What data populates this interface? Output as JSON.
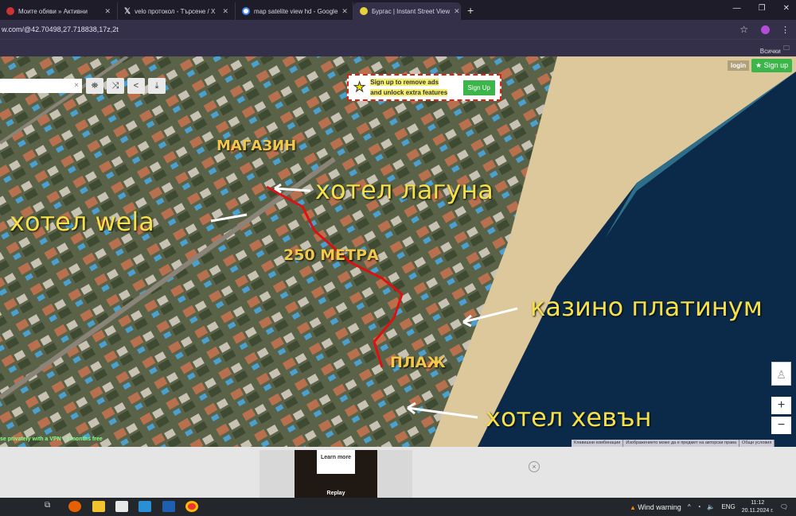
{
  "browser": {
    "tabs": [
      {
        "label": "Моите обяви » Активни",
        "active": false
      },
      {
        "label": "velo протокол - Търсене / X",
        "active": false
      },
      {
        "label": "map satelite view hd - Google",
        "active": false
      },
      {
        "label": "Бургас | Instant Street View",
        "active": true
      }
    ],
    "url": "w.com/@42.70498,27.718838,17z,2t",
    "bookmarks_label": "Всички отметки",
    "profile_initial": "s"
  },
  "page": {
    "search_clear": "×",
    "ad_banner": {
      "line1": "Sign up to remove ads",
      "line2": "and unlock extra features",
      "button": "Sign Up"
    },
    "login": "login",
    "signup": "Sign up",
    "zoom_in": "+",
    "zoom_out": "−",
    "vpn_text": "se privately with a VPN - 3 months free",
    "attribution": [
      "Клавишни комбинации",
      "Изображението може да е предмет на авторски права",
      "Общи условия"
    ],
    "annotations": {
      "shop": "МАГАЗИН",
      "hotel_laguna": "хотел лагуна",
      "hotel_wela": "хотел wela",
      "distance": "250 МЕТРА",
      "casino": "казино платинум",
      "beach": "ПЛАЖ",
      "hotel_heaven": "хотел хевън"
    }
  },
  "ad": {
    "learn_more": "Learn more",
    "replay": "Replay",
    "close": "×"
  },
  "taskbar": {
    "weather": "Wind warning",
    "lang": "ENG",
    "time": "11:12",
    "date": "20.11.2024 г."
  }
}
